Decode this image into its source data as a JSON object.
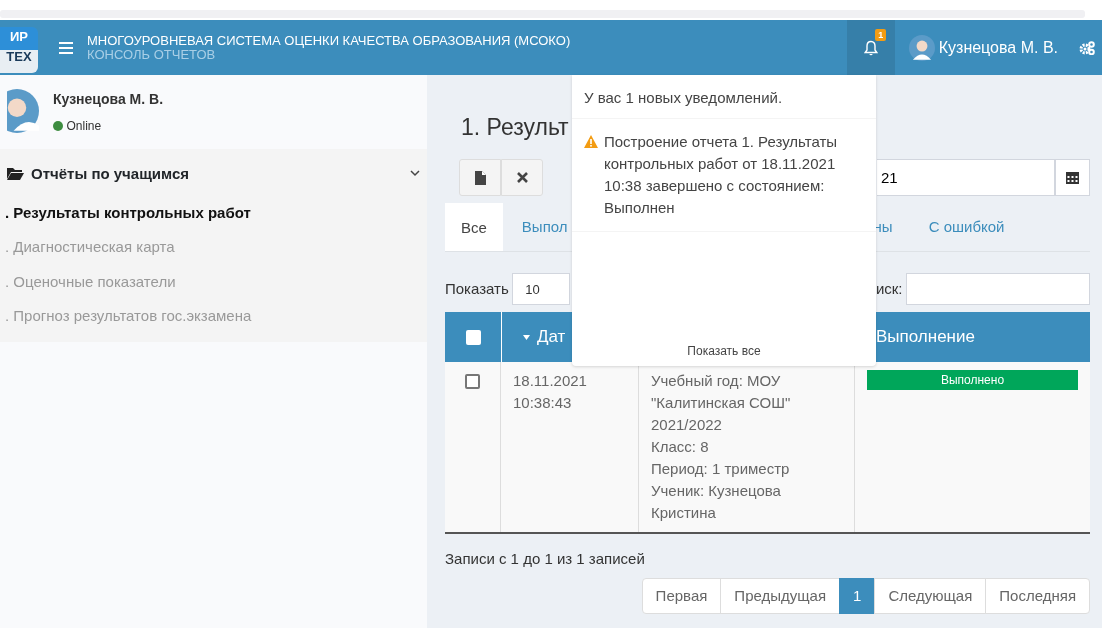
{
  "header": {
    "logo_top": "ИР",
    "logo_bottom": "ТЕХ",
    "title": "МНОГОУРОВНЕВАЯ СИСТЕМА ОЦЕНКИ КАЧЕСТВА ОБРАЗОВАНИЯ (МСОКО)",
    "subtitle": "КОНСОЛЬ ОТЧЕТОВ",
    "notification_count": "1",
    "user_name": "Кузнецова М. В."
  },
  "sidebar": {
    "user_name": "Кузнецова М. В.",
    "status": "Online",
    "group": {
      "label": "Отчёты по учащимся",
      "expanded": true,
      "items": [
        {
          "label": ". Результаты контрольных работ",
          "selected": true
        },
        {
          "label": ". Диагностическая карта",
          "selected": false
        },
        {
          "label": ". Оценочные показатели",
          "selected": false
        },
        {
          "label": ". Прогноз результатов гос.экзамена",
          "selected": false
        }
      ]
    }
  },
  "content": {
    "title": "1. Результ",
    "date_field": {
      "value": "21"
    },
    "tabs": [
      {
        "label": "Все",
        "selected": true
      },
      {
        "label": "Выпол",
        "selected": false
      },
      {
        "label": "ны",
        "selected": false
      },
      {
        "label": "С ошибкой",
        "selected": false
      }
    ],
    "show_label": "Показать",
    "show_value": "10",
    "search_label": "иск:",
    "table": {
      "header_checked": false,
      "columns": [
        "Дат",
        "Выполнение"
      ],
      "rows": [
        {
          "checked": false,
          "date_lines": [
            "18.11.2021",
            "10:38:43"
          ],
          "params_lines": [
            "Учебный год: МОУ",
            "\"Калитинская СОШ\"",
            "2021/2022",
            "Класс: 8",
            "Период: 1 триместр",
            "Ученик: Кузнецова",
            "Кристина"
          ],
          "status": {
            "text": "Выполнено",
            "kind": "success"
          }
        }
      ]
    },
    "info": "Записи с 1 до 1 из 1 записей",
    "pagination": [
      {
        "label": "Первая",
        "selected": false
      },
      {
        "label": "Предыдущая",
        "selected": false
      },
      {
        "label": "1",
        "selected": true
      },
      {
        "label": "Следующая",
        "selected": false
      },
      {
        "label": "Последняя",
        "selected": false
      }
    ]
  },
  "notifications": {
    "header": "У вас 1 новых уведомлений.",
    "items": [
      {
        "text": "Построение отчета 1. Результаты контрольных работ от 18.11.2021 10:38 завершено с состоянием: Выполнен"
      }
    ],
    "footer": "Показать все"
  }
}
